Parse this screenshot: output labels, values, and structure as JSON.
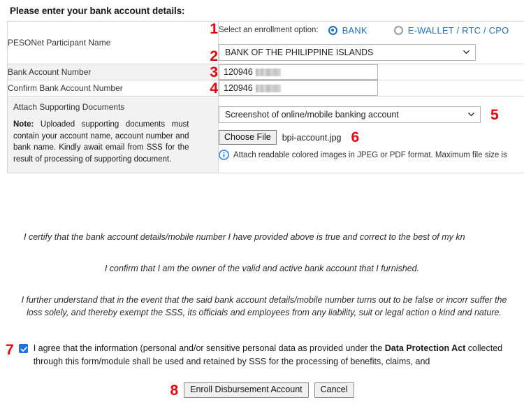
{
  "heading": "Please enter your bank account details:",
  "form": {
    "rows": [
      {
        "label": "PESONet Participant Name",
        "step_a": "1",
        "step_b": "2",
        "enrollment_prompt": "Select an enrollment option:",
        "options": [
          {
            "label": "BANK",
            "selected": true
          },
          {
            "label": "E-WALLET / RTC / CPO",
            "selected": false
          }
        ],
        "bank_select_value": "BANK OF THE PHILIPPINE ISLANDS"
      },
      {
        "label": "Bank Account Number",
        "step": "3",
        "value": "120946"
      },
      {
        "label": "Confirm Bank Account Number",
        "step": "4",
        "value": "120946"
      },
      {
        "label": "Attach Supporting Documents",
        "note_prefix": "Note:",
        "note": " Uploaded supporting documents must contain your account name, account number and bank name. Kindly await email from SSS for the result of processing of supporting document.",
        "doc_select_value": "Screenshot of online/mobile banking account",
        "step_doc": "5",
        "choose_file_label": "Choose File",
        "file_name": "bpi-account.jpg",
        "step_file": "6",
        "info_text": "Attach readable colored images in JPEG or PDF format. Maximum file size is"
      }
    ]
  },
  "certification": {
    "line1": "I certify that the bank account details/mobile number I have provided above is true and correct to the best of my kn",
    "line2": "I confirm that I am the owner of the valid and active bank account that I furnished.",
    "line3": "I further understand that in the event that the said bank account details/mobile number turns out to be false or incorr suffer the loss solely, and thereby exempt the SSS, its officials and employees from any liability, suit or legal action o kind and nature."
  },
  "agreement": {
    "step": "7",
    "checked": true,
    "text_before": "I agree that the information (personal and/or sensitive personal data as provided under the ",
    "bold_term": "Data Protection Act",
    "text_after": " collected through this form/module shall be used and retained by SSS for the processing of benefits, claims, and"
  },
  "actions": {
    "step": "8",
    "submit_label": "Enroll Disbursement Account",
    "cancel_label": "Cancel"
  },
  "colors": {
    "step_number": "#e8000d",
    "radio_accent": "#1573c6",
    "radio_label": "#1f6fb2",
    "checkbox": "#1a73e8",
    "row_grey": "#f2f2f2",
    "border": "#d6d6d6"
  }
}
